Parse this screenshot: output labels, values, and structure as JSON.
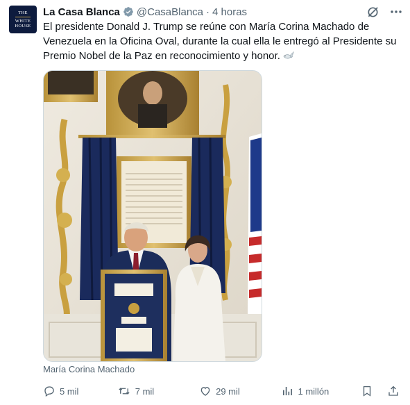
{
  "author": {
    "avatar_lines": [
      "THE",
      "WHITE",
      "HOUSE"
    ],
    "name": "La Casa Blanca",
    "handle": "@CasaBlanca",
    "separator": "·",
    "time": "4 horas"
  },
  "post": {
    "text": "El presidente Donald J. Trump se reúne con María Corina Machado de Venezuela en la Oficina Oval, durante la cual ella le entregó al Presidente su Premio Nobel de la Paz en reconocimiento y honor.",
    "caption": "María Corina Machado"
  },
  "metrics": {
    "replies": "5 mil",
    "reposts": "7 mil",
    "likes": "29 mil",
    "views": "1 millón"
  },
  "colors": {
    "text": "#0f1419",
    "secondary": "#536471",
    "verified_badge": "#829aab",
    "avatar_bg": "#0d1b3e"
  },
  "icons": [
    "verified-badge-icon",
    "grok-icon",
    "more-icon",
    "dove-emoji-icon",
    "reply-icon",
    "repost-icon",
    "like-icon",
    "views-icon",
    "bookmark-icon",
    "share-icon"
  ]
}
